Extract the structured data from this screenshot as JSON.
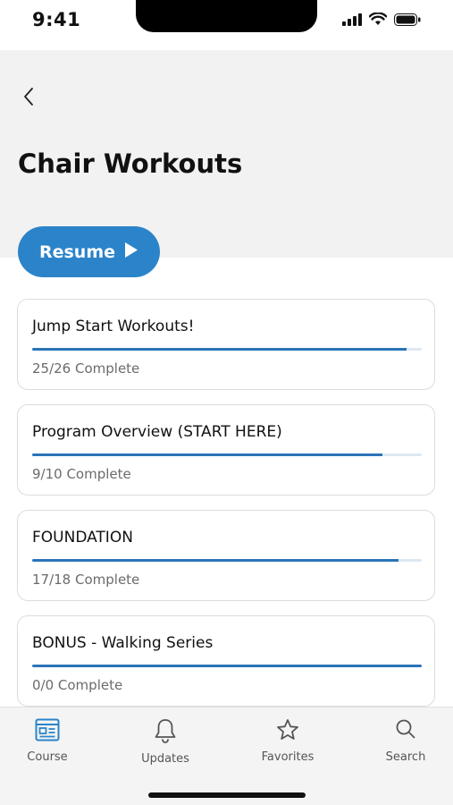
{
  "status_bar": {
    "time": "9:41",
    "icons": [
      "signal-icon",
      "wifi-icon",
      "battery-icon"
    ]
  },
  "header": {
    "back_icon": "chevron-left-icon",
    "title": "Chair Workouts"
  },
  "resume": {
    "label": "Resume",
    "icon": "play-icon",
    "color": "#2b84c9"
  },
  "modules": [
    {
      "title": "Jump Start Workouts!",
      "status": "25/26 Complete",
      "progress": 0.96
    },
    {
      "title": "Program Overview (START HERE)",
      "status": "9/10 Complete",
      "progress": 0.9
    },
    {
      "title": "FOUNDATION",
      "status": "17/18 Complete",
      "progress": 0.94
    },
    {
      "title": "BONUS - Walking Series",
      "status": "0/0 Complete",
      "progress": 1.0
    }
  ],
  "tabs": [
    {
      "label": "Course",
      "icon": "course-icon",
      "active": true
    },
    {
      "label": "Updates",
      "icon": "bell-icon",
      "active": false
    },
    {
      "label": "Favorites",
      "icon": "star-icon",
      "active": false
    },
    {
      "label": "Search",
      "icon": "search-icon",
      "active": false
    }
  ],
  "colors": {
    "accent": "#2b84c9",
    "progress": "#2b74b8",
    "header_bg": "#f2f2f2"
  }
}
